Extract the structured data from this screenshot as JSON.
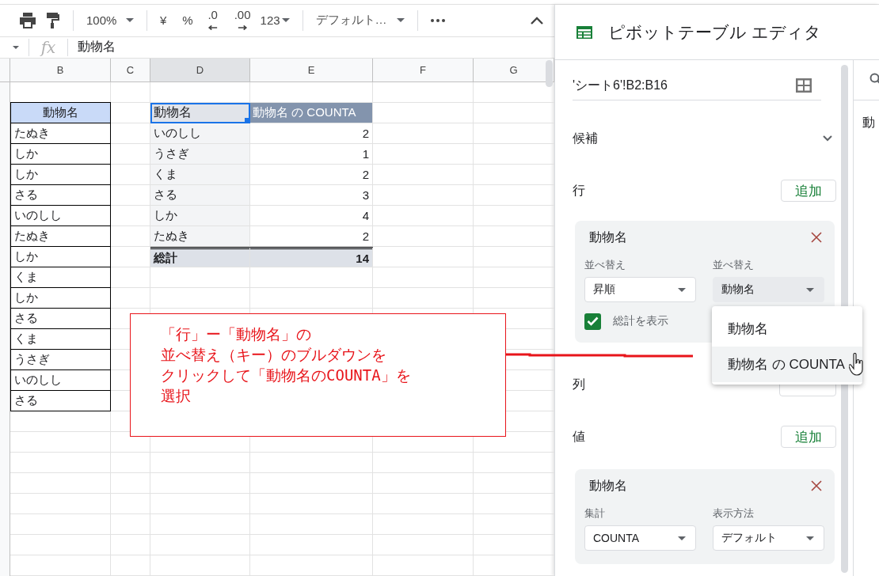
{
  "toolbar": {
    "zoom": "100%",
    "currency": "¥",
    "percent": "%",
    "decrease_decimals": ".0",
    "increase_decimals": ".00",
    "number_format": "123",
    "font": "デフォルト…"
  },
  "formula_bar": {
    "function_label": "fx",
    "value": "動物名"
  },
  "columns": [
    {
      "label": "B",
      "selected": false
    },
    {
      "label": "C",
      "selected": false
    },
    {
      "label": "D",
      "selected": true
    },
    {
      "label": "E",
      "selected": false
    },
    {
      "label": "F",
      "selected": false
    },
    {
      "label": "G",
      "selected": false
    }
  ],
  "source_data": {
    "header": "動物名",
    "rows": [
      "たぬき",
      "しか",
      "しか",
      "さる",
      "いのしし",
      "たぬき",
      "しか",
      "くま",
      "しか",
      "さる",
      "くま",
      "うさぎ",
      "いのしし",
      "さる"
    ]
  },
  "pivot_table": {
    "headers": [
      {
        "label": "動物名",
        "selected": true
      },
      {
        "label": "動物名 の COUNTA",
        "selected": false
      }
    ],
    "rows": [
      {
        "name": "いのしし",
        "count": "2"
      },
      {
        "name": "うさぎ",
        "count": "1"
      },
      {
        "name": "くま",
        "count": "2"
      },
      {
        "name": "さる",
        "count": "3"
      },
      {
        "name": "しか",
        "count": "4"
      },
      {
        "name": "たぬき",
        "count": "2"
      }
    ],
    "total": {
      "label": "総計",
      "value": "14"
    }
  },
  "callout": {
    "lines": [
      "「行」ー「動物名」の",
      "並べ替え（キー）のブルダウンを",
      "クリックして「動物名のCOUNTA」を",
      "選択"
    ]
  },
  "editor": {
    "title": "ピボットテーブル エディタ",
    "range": "'シート6'!B2:B16",
    "suggestions": {
      "label": "候補",
      "expanded": false
    },
    "rows_section": {
      "label": "行",
      "add": "追加",
      "field": {
        "name": "動物名",
        "sort_order": {
          "label": "並べ替え",
          "value": "昇順"
        },
        "sort_by": {
          "label": "並べ替え",
          "value": "動物名",
          "open": true
        },
        "show_totals": {
          "label": "総計を表示",
          "checked": true
        }
      }
    },
    "menu": {
      "options": [
        {
          "label": "動物名",
          "hovered": false
        },
        {
          "label": "動物名 の COUNTA",
          "hovered": true
        }
      ]
    },
    "columns_section": {
      "label": "列"
    },
    "values_section": {
      "label": "値",
      "add": "追加",
      "field": {
        "name": "動物名",
        "summarize": {
          "label": "集計",
          "value": "COUNTA"
        },
        "show_as": {
          "label": "表示方法",
          "value": "デフォルト"
        }
      }
    }
  },
  "side_panel": {
    "text": "動"
  }
}
